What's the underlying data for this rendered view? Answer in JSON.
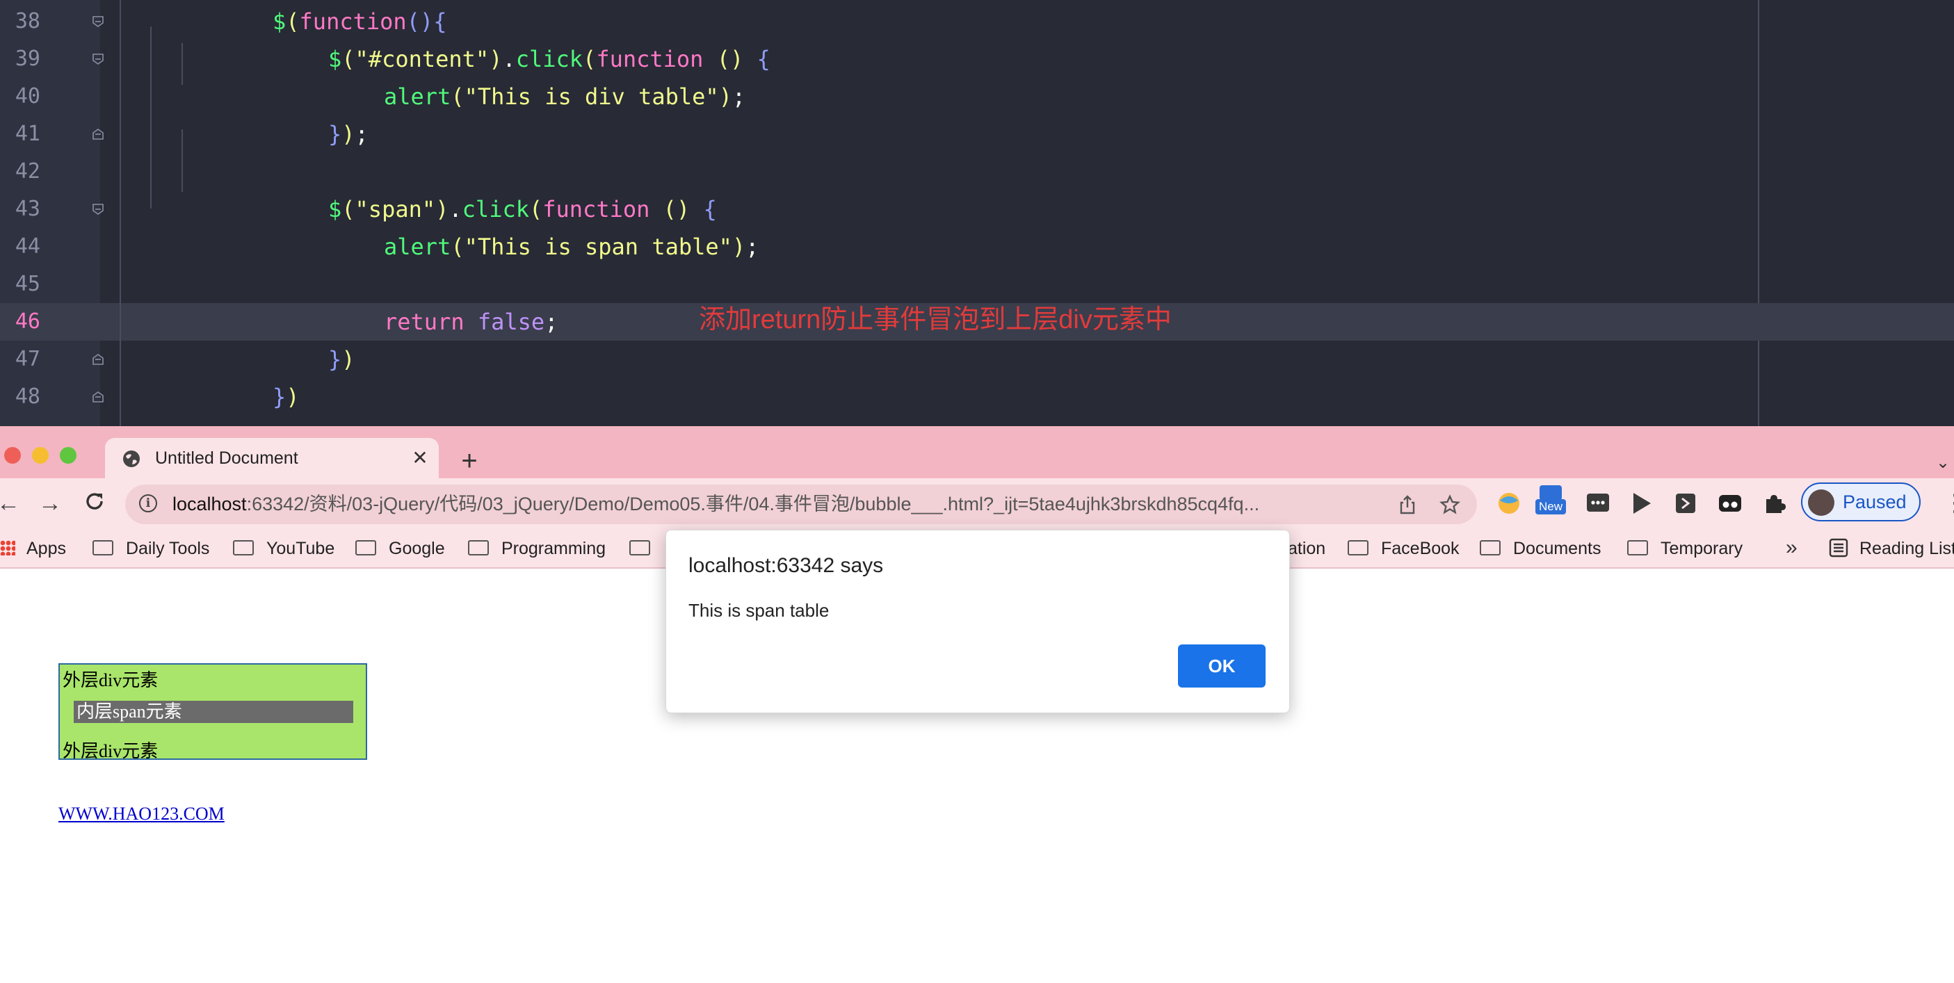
{
  "editor": {
    "lines": [
      {
        "num": "38",
        "tokens": [
          {
            "t": "$",
            "c": "k-call"
          },
          {
            "t": "(",
            "c": "k-br1"
          },
          {
            "t": "function",
            "c": "k-fn"
          },
          {
            "t": "()",
            "c": "k-br2"
          },
          {
            "t": "{",
            "c": "k-br2"
          }
        ]
      },
      {
        "num": "39",
        "tokens": [
          {
            "t": "$",
            "c": "k-call"
          },
          {
            "t": "(",
            "c": "k-br1"
          },
          {
            "t": "\"#content\"",
            "c": "k-str"
          },
          {
            "t": ")",
            "c": "k-br1"
          },
          {
            "t": ".",
            "c": ""
          },
          {
            "t": "click",
            "c": "k-call"
          },
          {
            "t": "(",
            "c": "k-br1"
          },
          {
            "t": "function",
            "c": "k-fn"
          },
          {
            "t": " ()",
            "c": "k-br1"
          },
          {
            "t": " {",
            "c": "k-br2"
          }
        ]
      },
      {
        "num": "40",
        "tokens": [
          {
            "t": "alert",
            "c": "k-call"
          },
          {
            "t": "(",
            "c": "k-br1"
          },
          {
            "t": "\"This is div table\"",
            "c": "k-str"
          },
          {
            "t": ")",
            "c": "k-br1"
          },
          {
            "t": ";",
            "c": ""
          }
        ]
      },
      {
        "num": "41",
        "tokens": [
          {
            "t": "}",
            "c": "k-br2"
          },
          {
            "t": ")",
            "c": "k-br1"
          },
          {
            "t": ";",
            "c": ""
          }
        ]
      },
      {
        "num": "42",
        "tokens": []
      },
      {
        "num": "43",
        "tokens": [
          {
            "t": "$",
            "c": "k-call"
          },
          {
            "t": "(",
            "c": "k-br1"
          },
          {
            "t": "\"span\"",
            "c": "k-str"
          },
          {
            "t": ")",
            "c": "k-br1"
          },
          {
            "t": ".",
            "c": ""
          },
          {
            "t": "click",
            "c": "k-call"
          },
          {
            "t": "(",
            "c": "k-br1"
          },
          {
            "t": "function",
            "c": "k-fn"
          },
          {
            "t": " ()",
            "c": "k-br1"
          },
          {
            "t": " {",
            "c": "k-br2"
          }
        ]
      },
      {
        "num": "44",
        "tokens": [
          {
            "t": "alert",
            "c": "k-call"
          },
          {
            "t": "(",
            "c": "k-br1"
          },
          {
            "t": "\"This is span table\"",
            "c": "k-str"
          },
          {
            "t": ")",
            "c": "k-br1"
          },
          {
            "t": ";",
            "c": ""
          }
        ]
      },
      {
        "num": "45",
        "tokens": []
      },
      {
        "num": "46",
        "tokens": [
          {
            "t": "return",
            "c": "k-kw"
          },
          {
            "t": " false",
            "c": "k-bool"
          },
          {
            "t": ";",
            "c": ""
          }
        ]
      },
      {
        "num": "47",
        "tokens": [
          {
            "t": "}",
            "c": "k-br2"
          },
          {
            "t": ")",
            "c": "k-br1"
          }
        ]
      },
      {
        "num": "48",
        "tokens": [
          {
            "t": "}",
            "c": "k-br2"
          },
          {
            "t": ")",
            "c": "k-br1"
          }
        ]
      }
    ],
    "annotation": "添加return防止事件冒泡到上层div元素中"
  },
  "browser": {
    "tab_title": "Untitled Document",
    "url_host": "localhost",
    "url_rest": ":63342/资料/03-jQuery/代码/03_jQuery/Demo/Demo05.事件/04.事件冒泡/bubble___.html?_ijt=5tae4ujhk3brskdh85cq4fq...",
    "new_badge": "New",
    "profile_label": "Paused",
    "bookmarks": [
      "Apps",
      "Daily Tools",
      "YouTube",
      "Google",
      "Programming",
      "ation",
      "FaceBook",
      "Documents",
      "Temporary",
      "Reading List"
    ],
    "bookmarks_more": "»"
  },
  "page": {
    "outer_div_text": "外层div元素",
    "inner_span_text": "内层span元素",
    "link_text": "WWW.HAO123.COM"
  },
  "dialog": {
    "title": "localhost:63342 says",
    "message": "This is span table",
    "ok_label": "OK"
  },
  "colors": {
    "editor_bg": "#282a36",
    "browser_chrome": "#f3b5c1",
    "outer_div_bg": "#a9e56a",
    "inner_span_bg": "#6b6b6b",
    "dialog_button": "#1a73e8",
    "annotation": "#e23b3b"
  }
}
